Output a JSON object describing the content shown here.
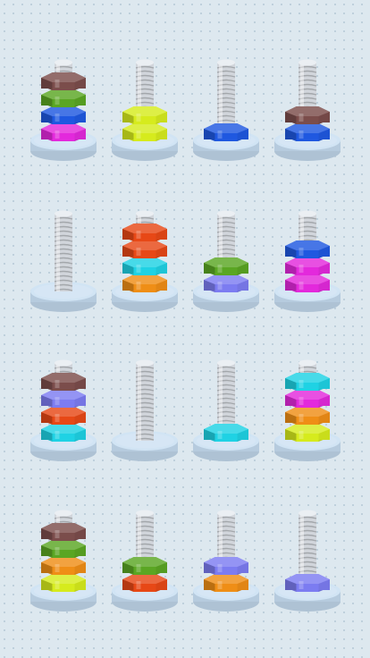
{
  "game": {
    "title": "",
    "mode": "nut-sort-puzzle"
  },
  "colors": {
    "brown": "#7b4d4b",
    "green": "#5aa623",
    "blue": "#1f58e0",
    "magenta": "#e329dc",
    "yellow": "#d6eb1d",
    "orange": "#ef8e16",
    "red": "#e74816",
    "cyan": "#1fd2e4",
    "purple": "#7c7cf1",
    "base": "#c6ddf1",
    "thread": "#e3e8ee"
  },
  "bolts": [
    {
      "id": "bolt-r1-c1",
      "nuts": [
        "magenta",
        "blue",
        "green",
        "brown"
      ]
    },
    {
      "id": "bolt-r1-c2",
      "nuts": [
        "yellow",
        "yellow"
      ]
    },
    {
      "id": "bolt-r1-c3",
      "nuts": [
        "blue"
      ]
    },
    {
      "id": "bolt-r1-c4",
      "nuts": [
        "blue",
        "brown"
      ]
    },
    {
      "id": "bolt-r2-c1",
      "nuts": []
    },
    {
      "id": "bolt-r2-c2",
      "nuts": [
        "orange",
        "cyan",
        "red",
        "red"
      ]
    },
    {
      "id": "bolt-r2-c3",
      "nuts": [
        "purple",
        "green"
      ]
    },
    {
      "id": "bolt-r2-c4",
      "nuts": [
        "magenta",
        "magenta",
        "blue"
      ]
    },
    {
      "id": "bolt-r3-c1",
      "nuts": [
        "cyan",
        "red",
        "purple",
        "brown"
      ]
    },
    {
      "id": "bolt-r3-c2",
      "nuts": []
    },
    {
      "id": "bolt-r3-c3",
      "nuts": [
        "cyan"
      ]
    },
    {
      "id": "bolt-r3-c4",
      "nuts": [
        "yellow",
        "orange",
        "magenta",
        "cyan"
      ]
    },
    {
      "id": "bolt-r4-c1",
      "nuts": [
        "yellow",
        "orange",
        "green",
        "brown"
      ]
    },
    {
      "id": "bolt-r4-c2",
      "nuts": [
        "red",
        "green"
      ]
    },
    {
      "id": "bolt-r4-c3",
      "nuts": [
        "orange",
        "purple"
      ]
    },
    {
      "id": "bolt-r4-c4",
      "nuts": [
        "purple"
      ]
    }
  ]
}
